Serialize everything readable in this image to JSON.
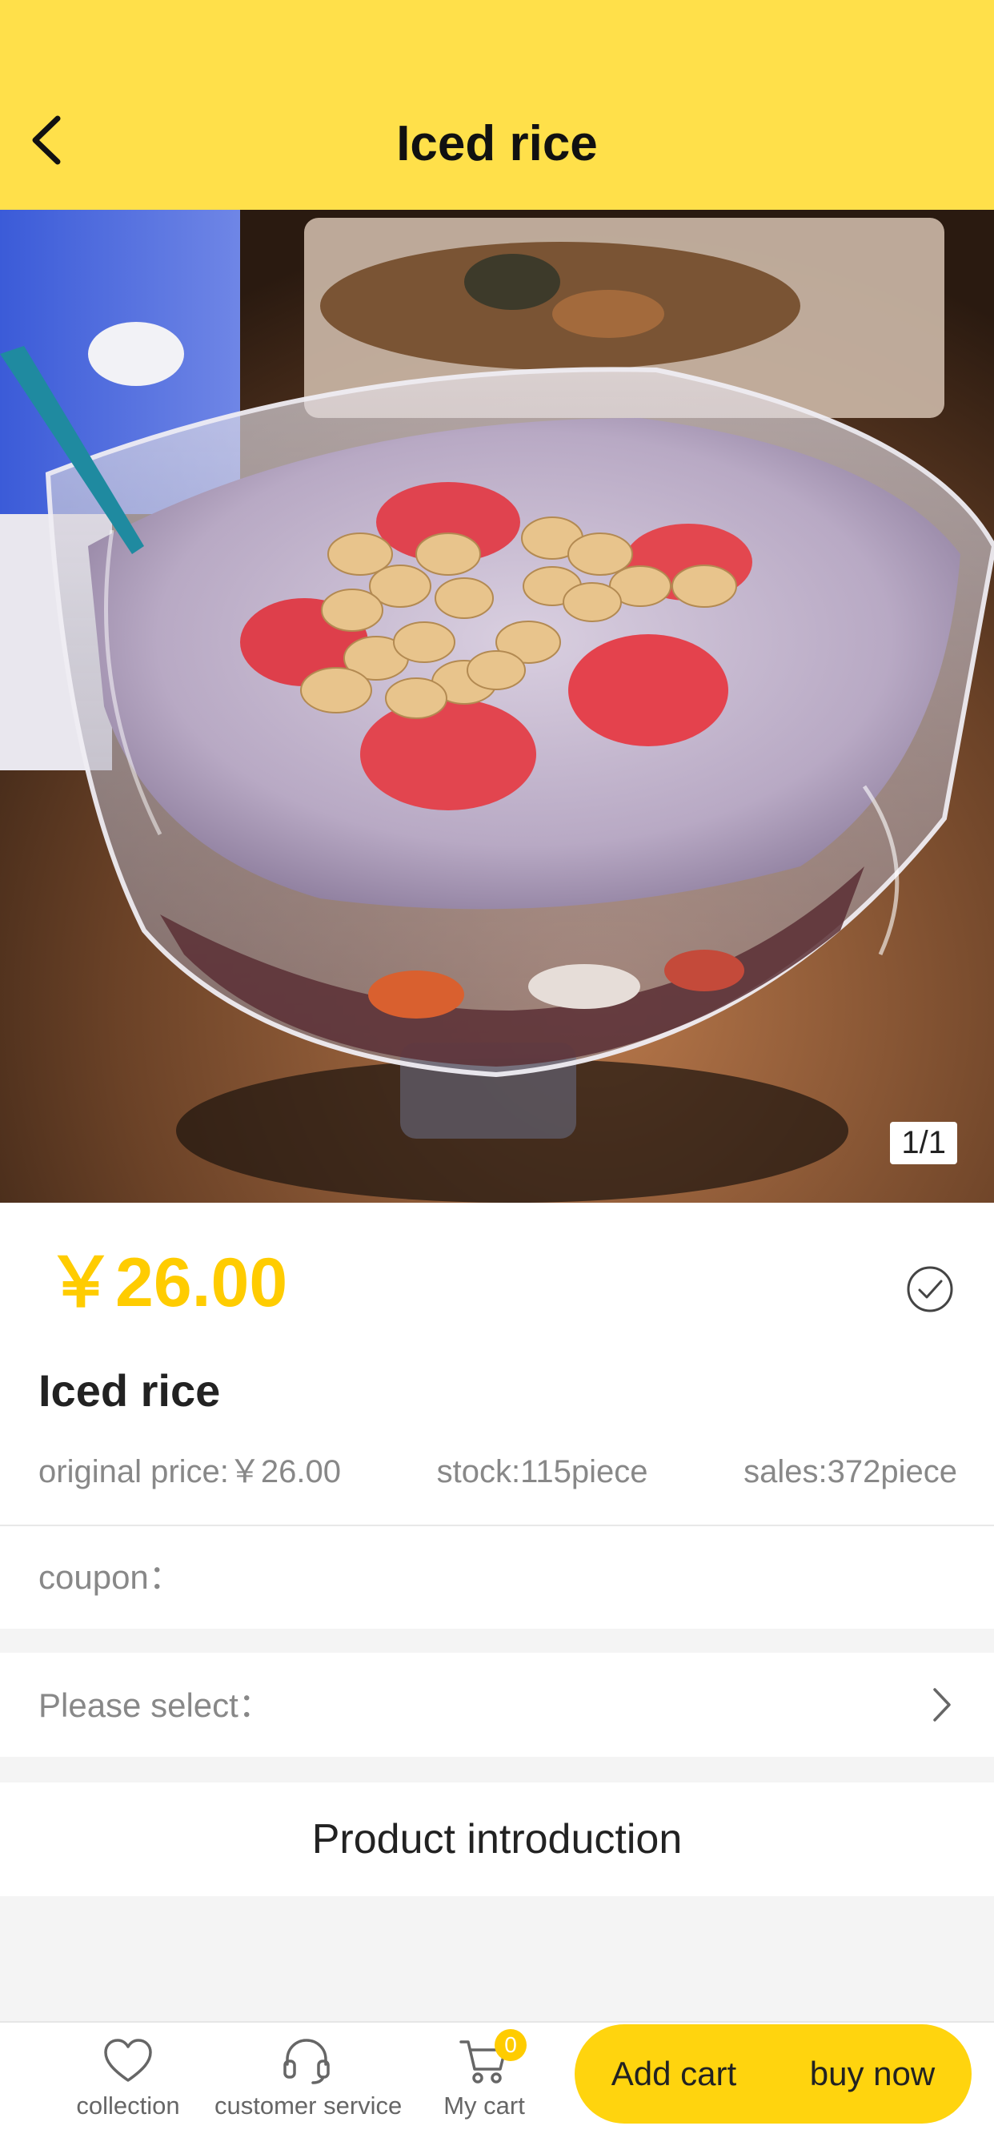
{
  "header": {
    "title": "Iced rice"
  },
  "gallery": {
    "counter": "1/1"
  },
  "product": {
    "price": "￥26.00",
    "name": "Iced rice",
    "original_price": "original price:￥26.00",
    "stock": "stock:115piece",
    "sales": "sales:372piece"
  },
  "coupon": {
    "label": "coupon："
  },
  "options": {
    "label": "Please select："
  },
  "intro": {
    "title": "Product introduction"
  },
  "bottom_bar": {
    "collection_label": "collection",
    "service_label": "customer service",
    "cart_label": "My cart",
    "cart_count": "0",
    "add_cart_label": "Add cart",
    "buy_now_label": "buy now"
  },
  "colors": {
    "header_bg": "#ffe04a",
    "accent": "#ffcc00",
    "button_bg": "#ffd40e"
  },
  "icons": [
    "chevron-left-icon",
    "check-circle-icon",
    "chevron-right-icon",
    "heart-icon",
    "headset-icon",
    "cart-icon"
  ]
}
